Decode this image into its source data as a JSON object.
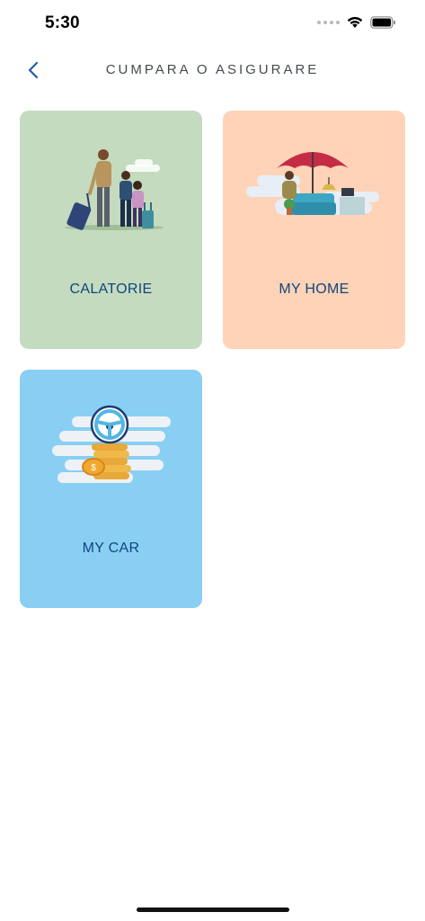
{
  "status_bar": {
    "time": "5:30"
  },
  "nav": {
    "title": "CUMPARA O ASIGURARE",
    "back_icon": "chevron-left-icon"
  },
  "cards": [
    {
      "label": "CALATORIE",
      "illustration": "family-travel-illustration",
      "color": "#c4dbbf"
    },
    {
      "label": "MY HOME",
      "illustration": "home-umbrella-illustration",
      "color": "#fed3b7"
    },
    {
      "label": "MY CAR",
      "illustration": "steering-wheel-coins-illustration",
      "color": "#89cff3"
    }
  ],
  "colors": {
    "accent": "#11457e",
    "title": "#444a50"
  }
}
